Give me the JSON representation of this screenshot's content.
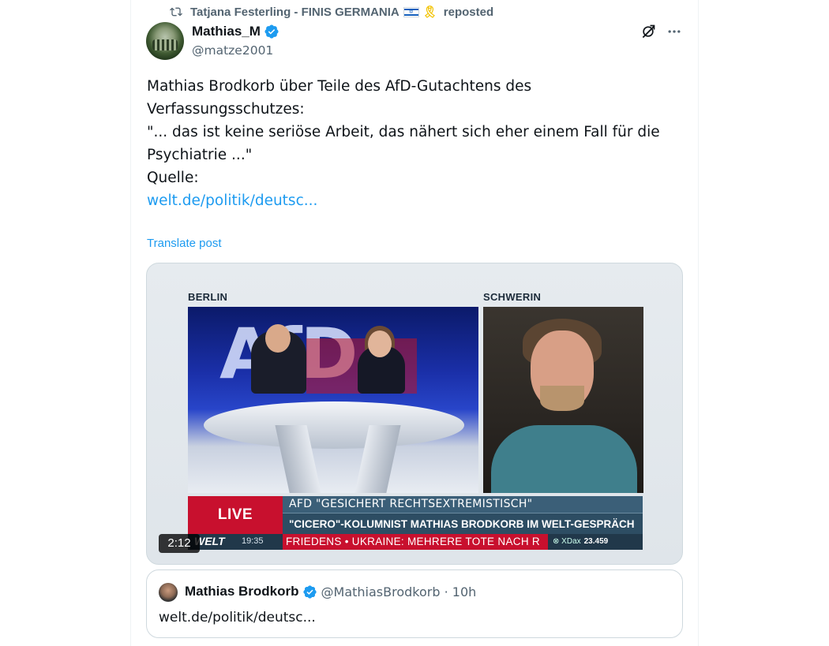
{
  "repost": {
    "icon": "repost-icon",
    "reposter": "Tatjana Festerling - FINIS GERMANIA",
    "flag_icon": "israel-flag-icon",
    "ribbon_icon": "yellow-ribbon-icon",
    "label": "reposted"
  },
  "post": {
    "author_name": "Mathias_M",
    "handle": "@matze2001",
    "verified_icon": "verified-badge-icon",
    "text_lines": [
      "Mathias Brodkorb über Teile des AfD-Gutachtens des Verfassungsschutzes:",
      "\"... das ist keine seriöse Arbeit, das nähert sich eher einem Fall für die Psychiatrie ...\"",
      "",
      "Quelle:"
    ],
    "link": "welt.de/politik/deutsc...",
    "translate": "Translate post",
    "colors": {
      "link": "#1d9bf0",
      "secondary": "#536471"
    }
  },
  "video": {
    "location_left": "BERLIN",
    "location_right": "SCHWERIN",
    "studio_text": "AfD",
    "live": "LIVE",
    "lower_third_1": "AFD \"GESICHERT RECHTSEXTREMISTISCH\"",
    "lower_third_2": "\"CICERO\"-KOLUMNIST MATHIAS BRODKORB IM WELT-GESPRÄCH",
    "ticker_brand": "WELT",
    "ticker_time": "19:35",
    "ticker_news": "FRIEDENS • UKRAINE: MEHRERE TOTE NACH R",
    "dax_label": "XDax",
    "dax_value": "23.459",
    "duration": "2:12",
    "colors": {
      "live_red": "#c8102e",
      "lower_third": "#2d4d63"
    }
  },
  "quoted": {
    "name": "Mathias Brodkorb",
    "handle_time": "@MathiasBrodkorb · 10h",
    "text": "welt.de/politik/deutsc..."
  },
  "actions": {
    "grok_icon": "grok-icon",
    "more_icon": "more-options-icon"
  }
}
